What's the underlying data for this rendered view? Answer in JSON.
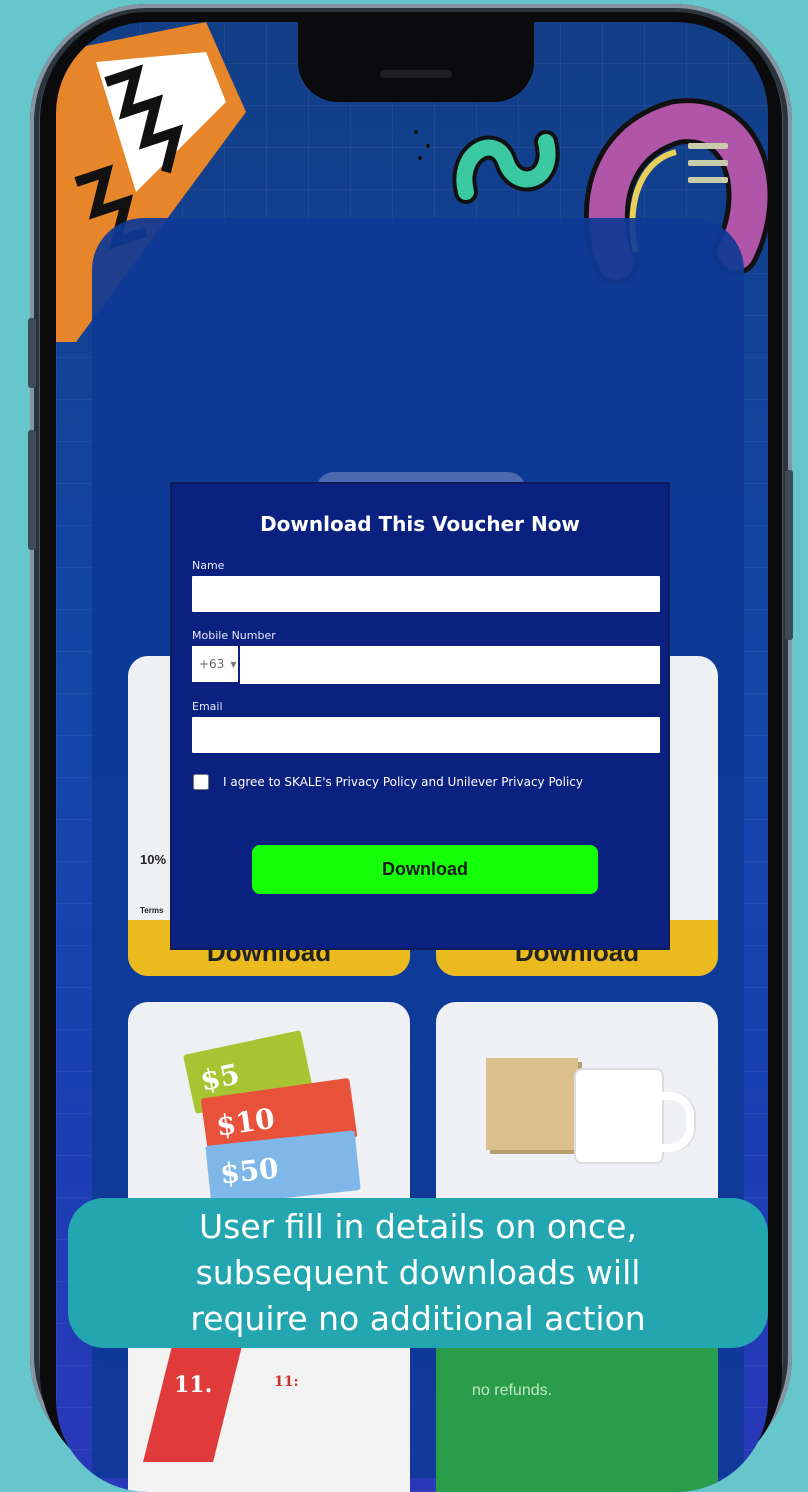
{
  "modal": {
    "title": "Download This Voucher Now",
    "name_label": "Name",
    "name_value": "",
    "mobile_label": "Mobile Number",
    "country_code": "+63",
    "mobile_value": "",
    "email_label": "Email",
    "email_value": "",
    "agree_text": "I agree to SKALE's Privacy Policy and Unilever Privacy Policy",
    "agree_checked": false,
    "download_label": "Download"
  },
  "background_cards": {
    "partial_discount": "10%",
    "partial_terms": "Terms",
    "card_download_label_left": "Download",
    "card_download_label_right": "Download",
    "voucher_amounts": [
      "$5",
      "$10",
      "$50"
    ],
    "bottom_left_labels": [
      "11.",
      "11:"
    ],
    "bottom_right_text": "no refunds."
  },
  "caption": {
    "lines": [
      "User fill in details on once,",
      "subsequent downloads will",
      "require no additional action"
    ]
  },
  "colors": {
    "page_bg": "#67c6cb",
    "modal_bg": "#0a2180",
    "download_button": "#14ff08",
    "caption_bg": "#23a6b0",
    "card_yellow": "#eaba1f"
  },
  "icons": [
    "menu-icon",
    "chevron-down-icon"
  ]
}
